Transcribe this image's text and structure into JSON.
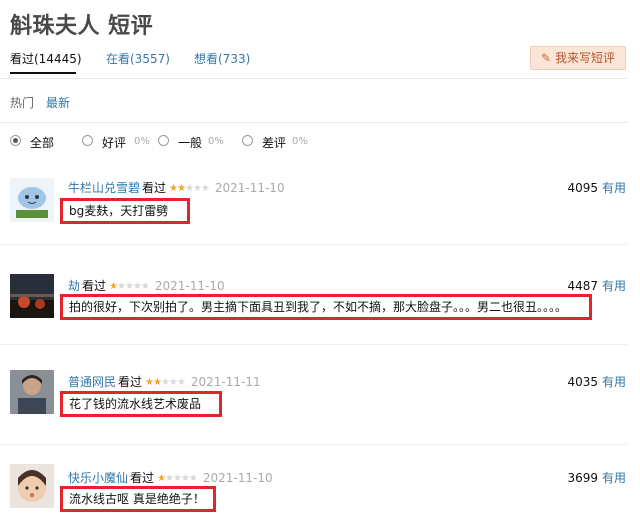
{
  "title": "斛珠夫人 短评",
  "tabs": [
    {
      "label": "看过(14445)"
    },
    {
      "label": "在看(3557)"
    },
    {
      "label": "想看(733)"
    }
  ],
  "write_button": {
    "label": "我来写短评"
  },
  "sort": {
    "hot": "热门",
    "latest": "最新"
  },
  "filters": [
    {
      "label": "全部",
      "pct": ""
    },
    {
      "label": "好评",
      "pct": "0%"
    },
    {
      "label": "一般",
      "pct": "0%"
    },
    {
      "label": "差评",
      "pct": "0%"
    }
  ],
  "reviews": [
    {
      "user": "牛栏山兑雪碧",
      "status": "看过",
      "stars": 2,
      "date": "2021-11-10",
      "votes": "4095",
      "useful": "有用",
      "comment": "bg麦麸，天打雷劈"
    },
    {
      "user": "劫",
      "status": "看过",
      "stars": 1,
      "date": "2021-11-10",
      "votes": "4487",
      "useful": "有用",
      "comment": "拍的很好，下次别拍了。男主摘下面具丑到我了，不如不摘，那大脸盘子。。。男二也很丑。。。。"
    },
    {
      "user": "普通网民",
      "status": "看过",
      "stars": 2,
      "date": "2021-11-11",
      "votes": "4035",
      "useful": "有用",
      "comment": "花了钱的流水线艺术废品"
    },
    {
      "user": "快乐小魔仙",
      "status": "看过",
      "stars": 1,
      "date": "2021-11-10",
      "votes": "3699",
      "useful": "有用",
      "comment": "流水线古呕 真是绝绝子！"
    }
  ],
  "colors": {
    "link": "#3377aa",
    "highlight": "#e0262a",
    "star": "#f5a623",
    "button_bg": "#fbe5d6"
  }
}
